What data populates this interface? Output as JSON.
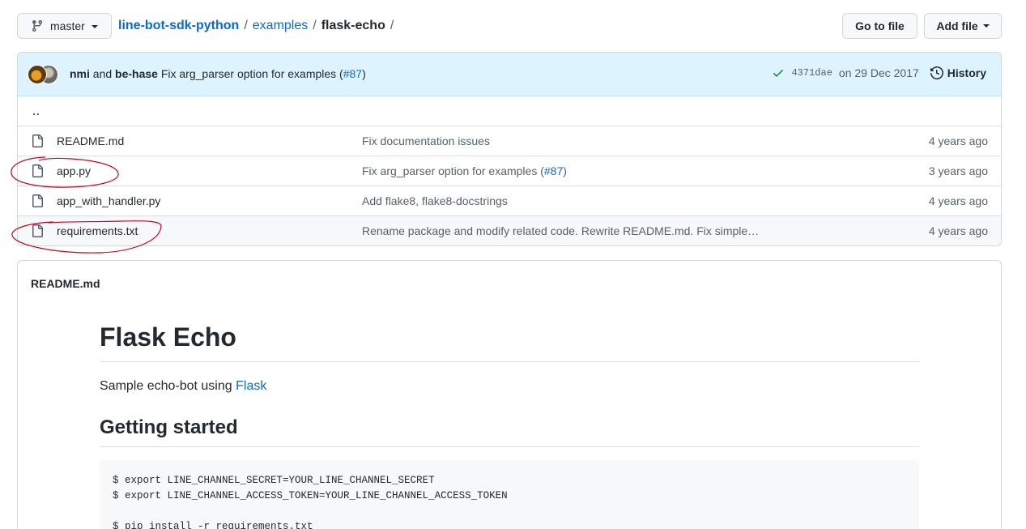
{
  "branch": {
    "name": "master"
  },
  "breadcrumb": {
    "repo": "line-bot-sdk-python",
    "sep1": "/",
    "folder": "examples",
    "sep2": "/",
    "current": "flask-echo",
    "sep3": "/"
  },
  "actions": {
    "goto_label": "Go to file",
    "add_label": "Add file"
  },
  "commit": {
    "author1": "nmi",
    "and": "and",
    "author2": "be-hase",
    "message_prefix": "Fix arg_parser option for examples (",
    "pr": "#87",
    "message_suffix": ")",
    "sha": "4371dae",
    "date": "on 29 Dec 2017",
    "history_label": "History"
  },
  "parent_dir": "..",
  "files": [
    {
      "name": "README.md",
      "msg": "Fix documentation issues",
      "msg_link": "",
      "msg_end": "",
      "age": "4 years ago"
    },
    {
      "name": "app.py",
      "msg": "Fix arg_parser option for examples (",
      "msg_link": "#87",
      "msg_end": ")",
      "age": "3 years ago"
    },
    {
      "name": "app_with_handler.py",
      "msg": "Add flake8, flake8-docstrings",
      "msg_link": "",
      "msg_end": "",
      "age": "4 years ago"
    },
    {
      "name": "requirements.txt",
      "msg": "Rename package and modify related code. Rewrite README.md. Fix simple…",
      "msg_link": "",
      "msg_end": "",
      "age": "4 years ago"
    }
  ],
  "readme": {
    "filename": "README.md",
    "title": "Flask Echo",
    "intro_text": "Sample echo-bot using ",
    "intro_link": "Flask",
    "section_title": "Getting started",
    "code_lines": [
      "$ export LINE_CHANNEL_SECRET=YOUR_LINE_CHANNEL_SECRET",
      "$ export LINE_CHANNEL_ACCESS_TOKEN=YOUR_LINE_CHANNEL_ACCESS_TOKEN",
      "",
      "$ pip install -r requirements.txt"
    ]
  },
  "colors": {
    "link": "#0969da",
    "commit_bg": "#ddf4ff",
    "annotation": "#d0021b",
    "success": "#1a7f37"
  }
}
